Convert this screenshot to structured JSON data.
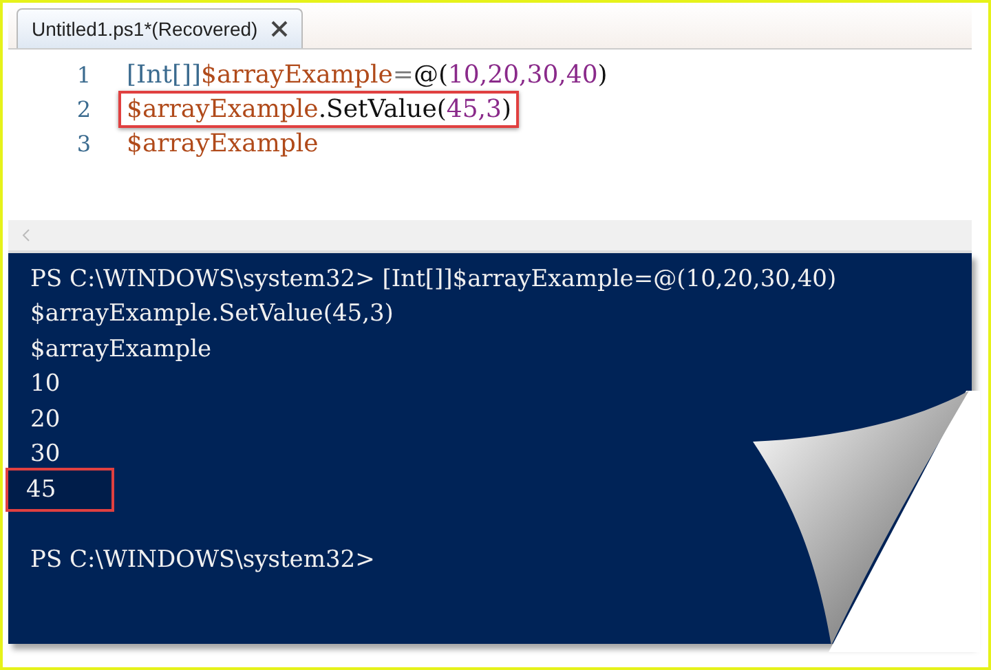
{
  "tab": {
    "title": "Untitled1.ps1*(Recovered)",
    "selected": true
  },
  "editor": {
    "lines": [
      {
        "number": "1",
        "highlighted": false,
        "tokens": [
          {
            "text": "[Int[]]",
            "kind": "type"
          },
          {
            "text": "$arrayExample",
            "kind": "variable"
          },
          {
            "text": "=",
            "kind": "operator"
          },
          {
            "text": "@(",
            "kind": "plain"
          },
          {
            "text": "10,20,30,40",
            "kind": "number"
          },
          {
            "text": ")",
            "kind": "plain"
          }
        ]
      },
      {
        "number": "2",
        "highlighted": true,
        "tokens": [
          {
            "text": "$arrayExample",
            "kind": "variable"
          },
          {
            "text": ".SetValue(",
            "kind": "plain"
          },
          {
            "text": "45,3",
            "kind": "number"
          },
          {
            "text": ")",
            "kind": "plain"
          }
        ]
      },
      {
        "number": "3",
        "highlighted": false,
        "tokens": [
          {
            "text": "$arrayExample",
            "kind": "variable"
          }
        ]
      }
    ]
  },
  "console": {
    "lines": [
      {
        "text": "PS C:\\WINDOWS\\system32> [Int[]]$arrayExample=@(10,20,30,40)",
        "highlighted": false
      },
      {
        "text": "$arrayExample.SetValue(45,3)",
        "highlighted": false
      },
      {
        "text": "$arrayExample",
        "highlighted": false
      },
      {
        "text": "10",
        "highlighted": false
      },
      {
        "text": "20",
        "highlighted": false
      },
      {
        "text": "30",
        "highlighted": false
      },
      {
        "text": "45",
        "highlighted": true
      }
    ],
    "prompt": "PS C:\\WINDOWS\\system32>"
  }
}
